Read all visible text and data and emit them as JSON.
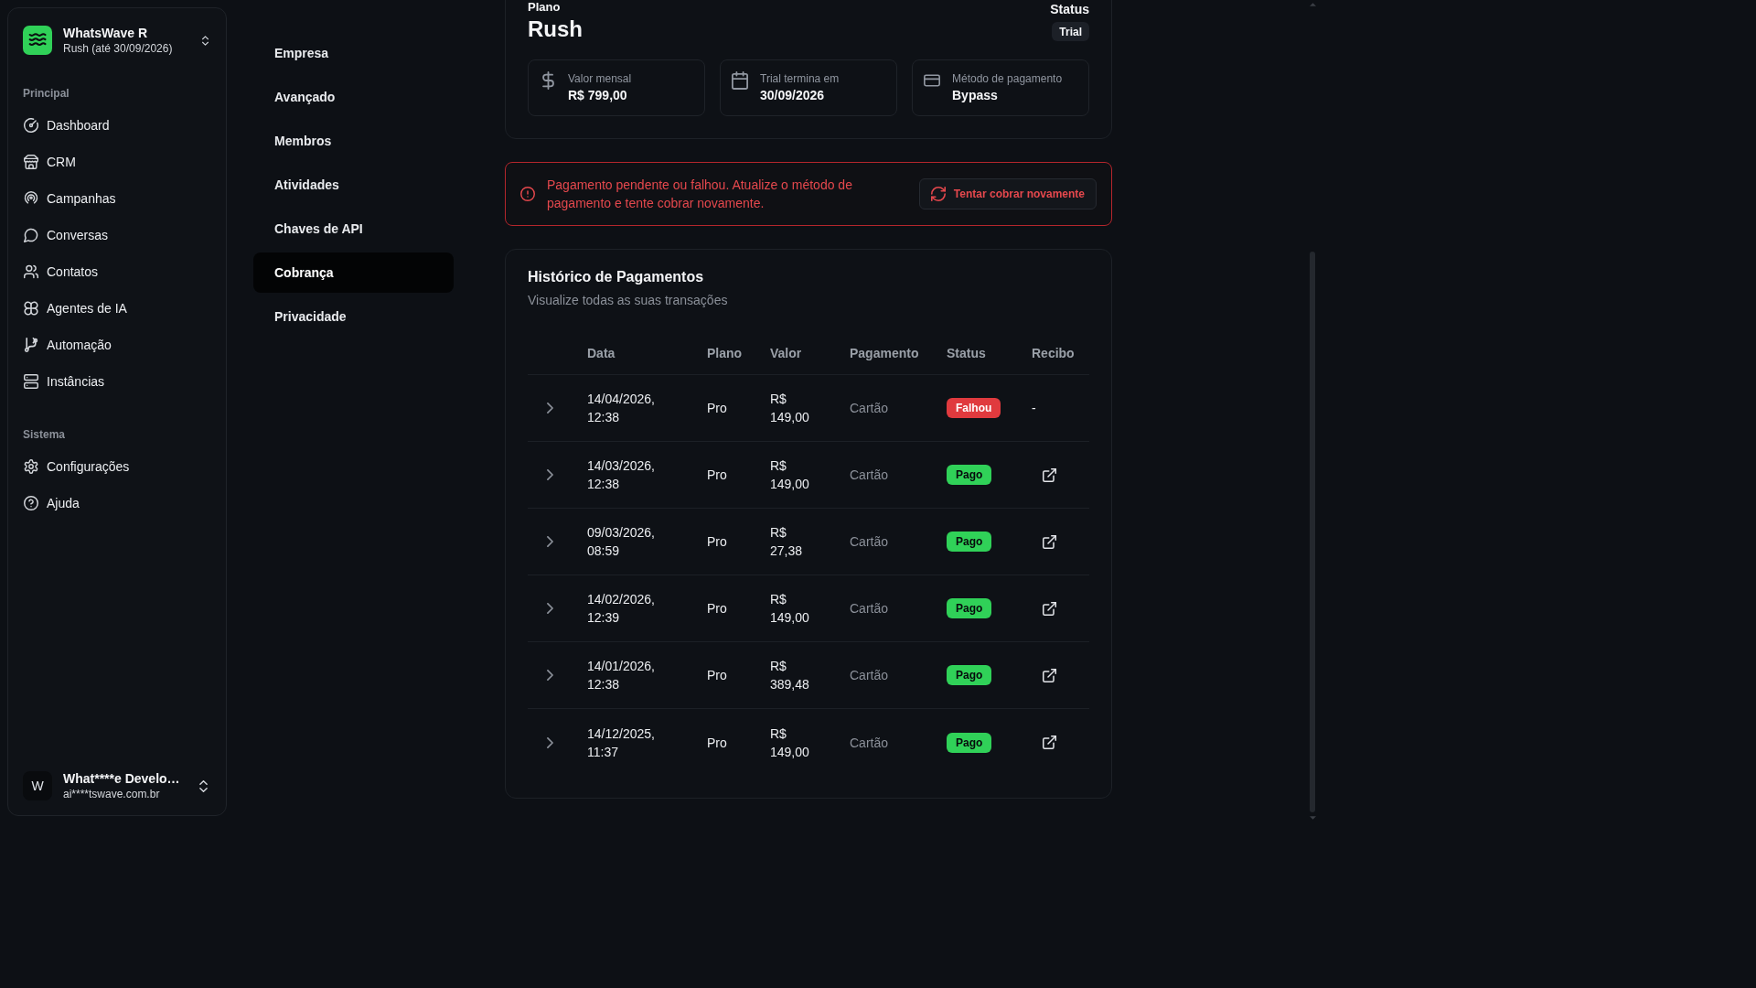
{
  "sidebar": {
    "workspace": {
      "name": "WhatsWave R",
      "subtitle": "Rush (até 30/09/2026)"
    },
    "sections": [
      {
        "title": "Principal",
        "items": [
          {
            "label": "Dashboard",
            "selected": false
          },
          {
            "label": "CRM",
            "selected": false
          },
          {
            "label": "Campanhas",
            "selected": false
          },
          {
            "label": "Conversas",
            "selected": false
          },
          {
            "label": "Contatos",
            "selected": false
          },
          {
            "label": "Agentes de IA",
            "selected": false
          },
          {
            "label": "Automação",
            "selected": false
          },
          {
            "label": "Instâncias",
            "selected": false
          }
        ]
      },
      {
        "title": "Sistema",
        "items": [
          {
            "label": "Configurações",
            "selected": false
          },
          {
            "label": "Ajuda",
            "selected": false
          }
        ]
      }
    ],
    "user": {
      "initial": "W",
      "name": "What****e Develo…",
      "email": "ai****tswave.com.br"
    }
  },
  "settings_nav": [
    {
      "label": "Empresa",
      "selected": false
    },
    {
      "label": "Avançado",
      "selected": false
    },
    {
      "label": "Membros",
      "selected": false
    },
    {
      "label": "Atividades",
      "selected": false
    },
    {
      "label": "Chaves de API",
      "selected": false
    },
    {
      "label": "Cobrança",
      "selected": true
    },
    {
      "label": "Privacidade",
      "selected": false
    }
  ],
  "plan_card": {
    "label": "Plano",
    "name": "Rush",
    "status_label": "Status",
    "status": "Trial",
    "stats": [
      {
        "label": "Valor mensal",
        "value": "R$ 799,00"
      },
      {
        "label": "Trial termina em",
        "value": "30/09/2026"
      },
      {
        "label": "Método de pagamento",
        "value": "Bypass"
      }
    ]
  },
  "alert": {
    "message": "Pagamento pendente ou falhou. Atualize o método de pagamento e tente cobrar novamente.",
    "button": "Tentar cobrar novamente"
  },
  "payment_history": {
    "title": "Histórico de Pagamentos",
    "subtitle": "Visualize todas as suas transações",
    "table": {
      "columns": [
        "Data",
        "Plano",
        "Valor",
        "Pagamento",
        "Status",
        "Recibo"
      ],
      "rows": [
        {
          "expanded": false,
          "date": "14/04/2026, 12:38",
          "plan": "Pro",
          "amount": "R$ 149,00",
          "method": "Cartão",
          "status": {
            "label": "Falhou",
            "color": "#e03a3e"
          },
          "receipt": {
            "kind": "text",
            "text": "-"
          }
        },
        {
          "expanded": false,
          "date": "14/03/2026, 12:38",
          "plan": "Pro",
          "amount": "R$ 149,00",
          "method": "Cartão",
          "status": {
            "label": "Pago",
            "color": "#30d158"
          },
          "receipt": {
            "kind": "link"
          }
        },
        {
          "expanded": false,
          "date": "09/03/2026, 08:59",
          "plan": "Pro",
          "amount": "R$ 27,38",
          "method": "Cartão",
          "status": {
            "label": "Pago",
            "color": "#30d158"
          },
          "receipt": {
            "kind": "link"
          }
        },
        {
          "expanded": false,
          "date": "14/02/2026, 12:39",
          "plan": "Pro",
          "amount": "R$ 149,00",
          "method": "Cartão",
          "status": {
            "label": "Pago",
            "color": "#30d158"
          },
          "receipt": {
            "kind": "link"
          }
        },
        {
          "expanded": false,
          "date": "14/01/2026, 12:38",
          "plan": "Pro",
          "amount": "R$ 389,48",
          "method": "Cartão",
          "status": {
            "label": "Pago",
            "color": "#30d158"
          },
          "receipt": {
            "kind": "link"
          }
        },
        {
          "expanded": false,
          "date": "14/12/2025, 11:37",
          "plan": "Pro",
          "amount": "R$ 149,00",
          "method": "Cartão",
          "status": {
            "label": "Pago",
            "color": "#30d158"
          },
          "receipt": {
            "kind": "link"
          }
        }
      ]
    }
  }
}
